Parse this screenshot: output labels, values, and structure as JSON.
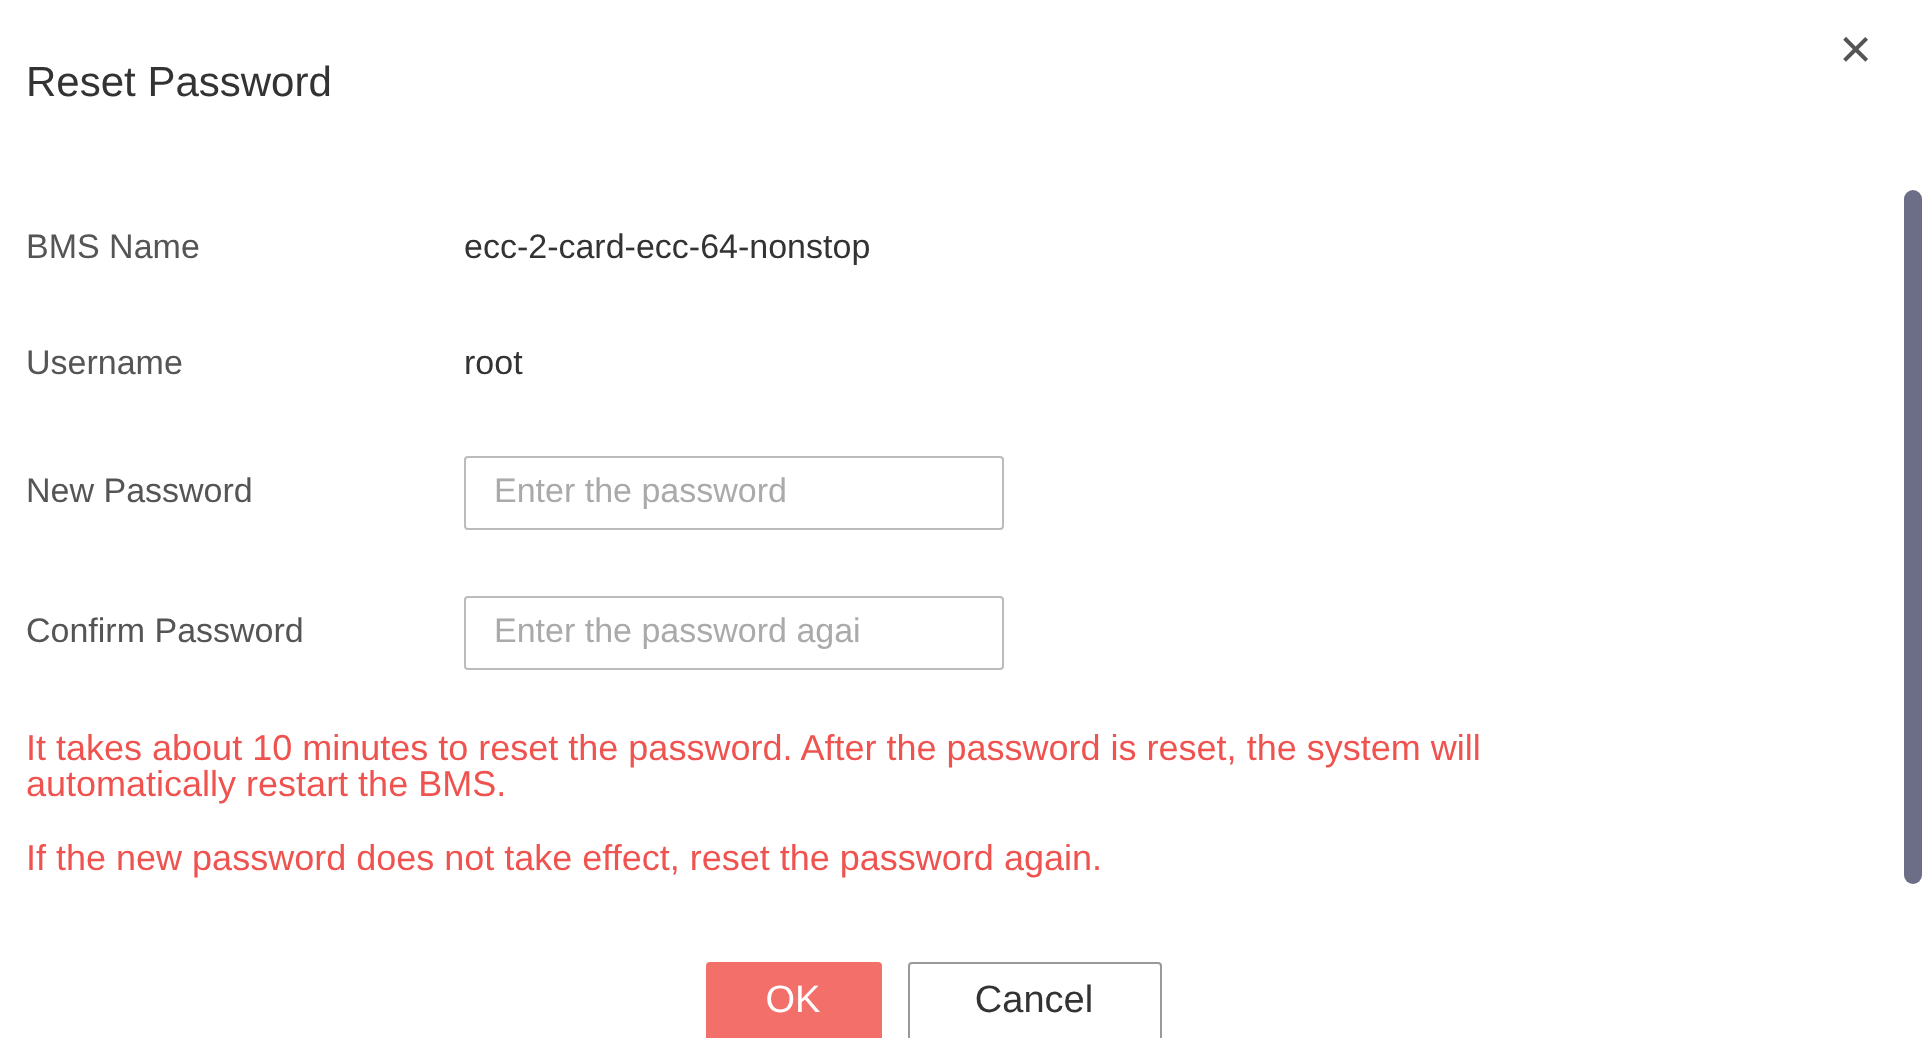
{
  "dialog": {
    "title": "Reset Password",
    "close": "×"
  },
  "info": [
    {
      "label": "BMS Name",
      "value": "ecc-2-card-ecc-64-nonstop"
    },
    {
      "label": "Username",
      "value": "root"
    }
  ],
  "fields": [
    {
      "label": "New Password",
      "placeholder": "Enter the password"
    },
    {
      "label": "Confirm Password",
      "placeholder": "Enter the password agai"
    }
  ],
  "notices": [
    "It takes about 10 minutes to reset the password. After the password is reset, the system will automatically restart the BMS.",
    "If the new password does not take effect, reset the password again."
  ],
  "buttons": [
    {
      "label": "OK",
      "kind": "primary"
    },
    {
      "label": "Cancel",
      "kind": "secondary"
    }
  ]
}
